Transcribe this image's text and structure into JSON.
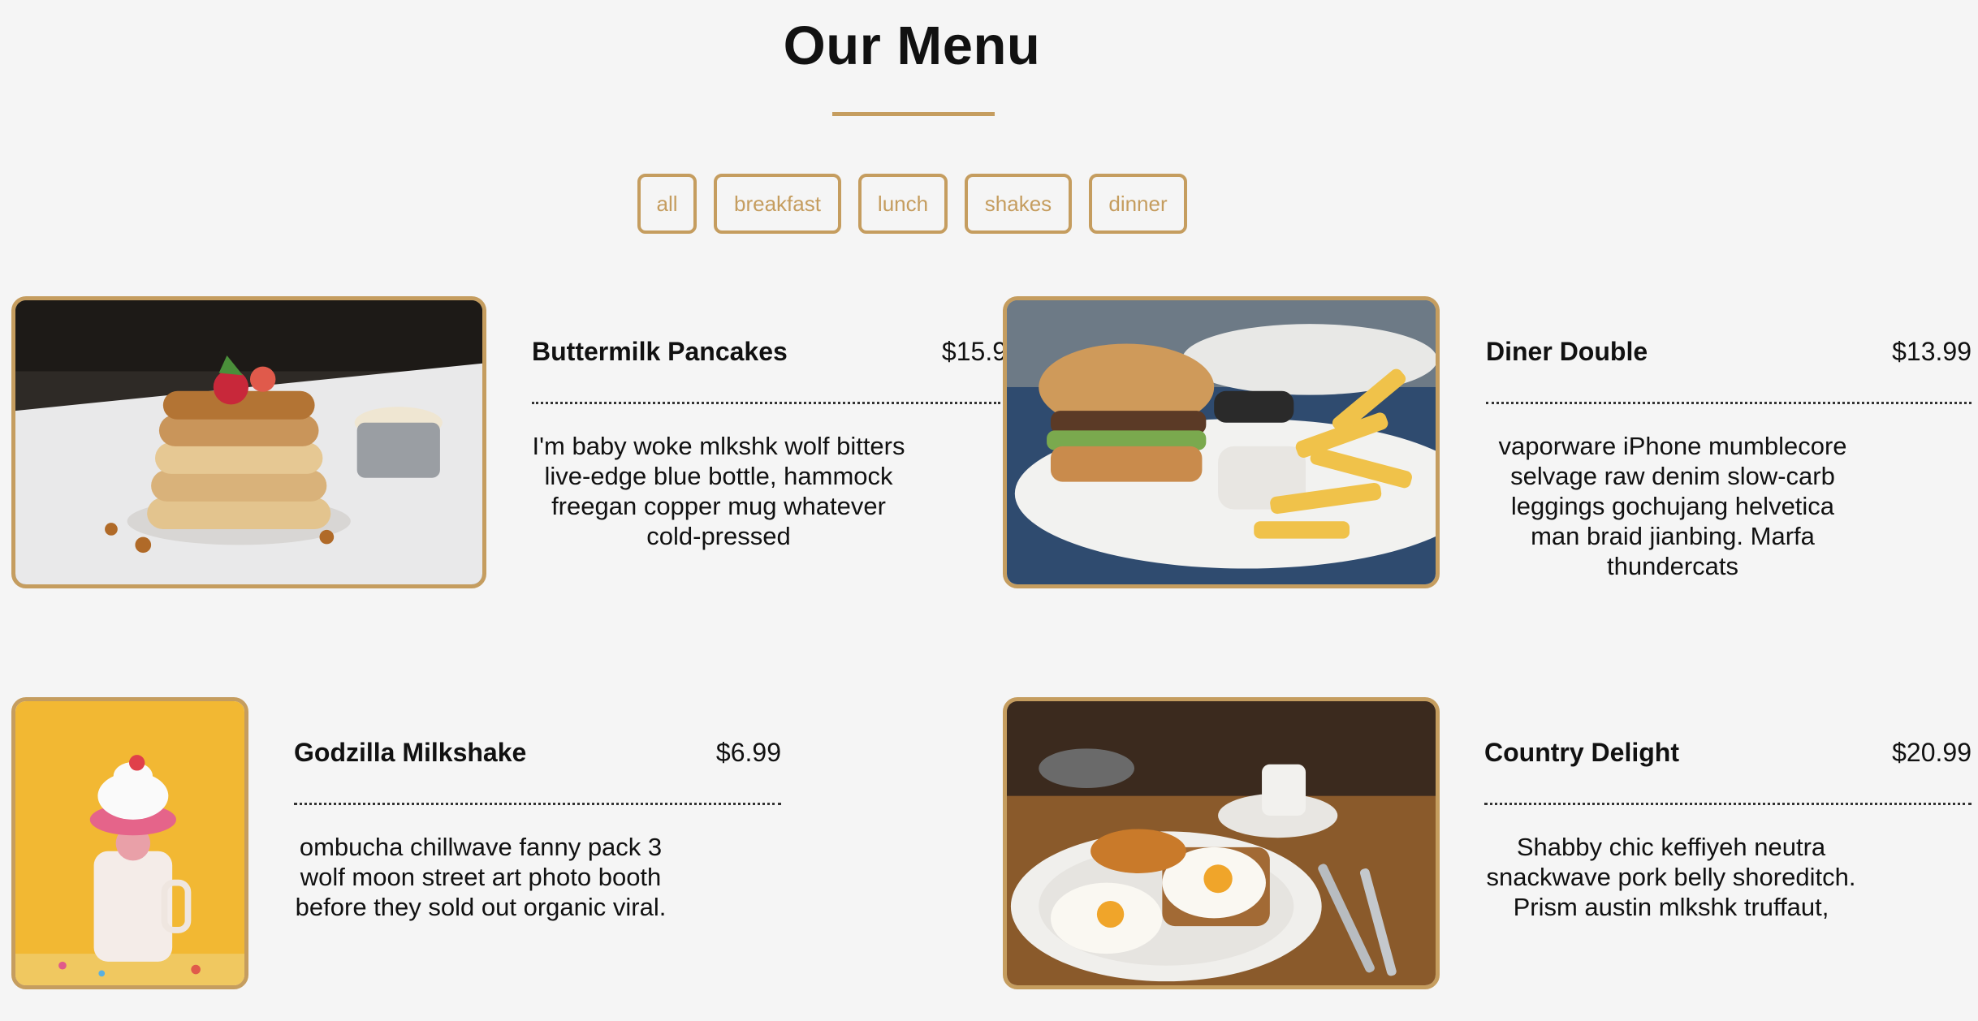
{
  "page": {
    "title": "Our Menu"
  },
  "filters": [
    "all",
    "breakfast",
    "lunch",
    "shakes",
    "dinner"
  ],
  "items": [
    {
      "name": "Buttermilk Pancakes",
      "price": "$15.9",
      "description": "I'm baby woke mlkshk wolf bitters live-edge blue bottle, hammock freegan copper mug whatever cold-pressed",
      "image": "pancakes-photo"
    },
    {
      "name": "Diner Double",
      "price": "$13.99",
      "description": "vaporware iPhone mumblecore selvage raw denim slow-carb leggings gochujang helvetica man braid jianbing. Marfa thundercats",
      "image": "burger-photo"
    },
    {
      "name": "Godzilla Milkshake",
      "price": "$6.99",
      "description": "ombucha chillwave fanny pack 3 wolf moon street art photo booth before they sold out organic viral.",
      "image": "milkshake-photo"
    },
    {
      "name": "Country Delight",
      "price": "$20.99",
      "description": "Shabby chic keffiyeh neutra snackwave pork belly shoreditch. Prism austin mlkshk truffaut,",
      "image": "eggs-photo"
    }
  ],
  "colors": {
    "accent": "#c59d5f",
    "background": "#f5f5f5",
    "text": "#111111"
  }
}
